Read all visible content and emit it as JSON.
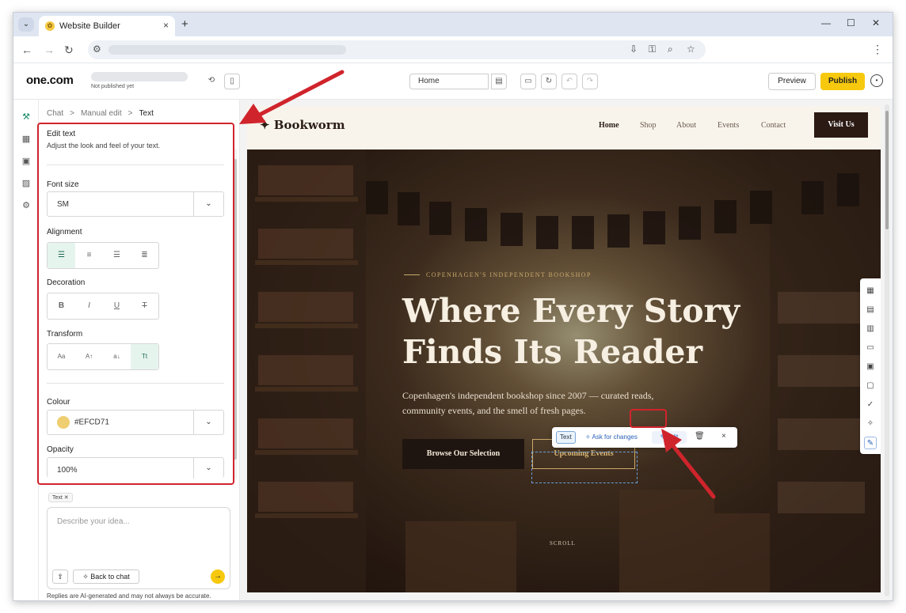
{
  "browser": {
    "tab_title": "Website Builder",
    "tab_close": "×",
    "new_tab": "+",
    "menu": "⋮"
  },
  "app": {
    "logo": "one.com",
    "status": "Not published yet",
    "page_select": "Home",
    "preview_label": "Preview",
    "publish_label": "Publish"
  },
  "panel": {
    "breadcrumb": [
      "Chat",
      "Manual edit",
      "Text"
    ],
    "breadcrumb_sep": ">",
    "title": "Edit text",
    "subtitle": "Adjust the look and feel of your text.",
    "font_size": {
      "label": "Font size",
      "value": "SM"
    },
    "alignment": {
      "label": "Alignment",
      "selected": "left"
    },
    "decoration": {
      "label": "Decoration",
      "options": [
        "B",
        "I",
        "U",
        "T"
      ]
    },
    "transform": {
      "label": "Transform",
      "options": [
        "Aa",
        "A↑",
        "a↓",
        "Tt"
      ],
      "selected": "Tt"
    },
    "colour": {
      "label": "Colour",
      "value": "#EFCD71",
      "swatch": "#EFCD71"
    },
    "opacity": {
      "label": "Opacity",
      "value": "100%"
    },
    "chip_label": "Text",
    "chip_close": "✕",
    "chat_placeholder": "Describe your idea...",
    "back_to_chat": "Back to chat",
    "disclaimer": "Replies are AI-generated and may not always be accurate."
  },
  "site": {
    "brand": "Bookworm",
    "nav": [
      "Home",
      "Shop",
      "About",
      "Events",
      "Contact"
    ],
    "visit_button": "Visit Us",
    "kicker": "COPENHAGEN'S INDEPENDENT BOOKSHOP",
    "headline_1": "Where Every Story",
    "headline_2": "Finds Its Reader",
    "sub_1": "Copenhagen's independent bookshop since 2007 — curated reads,",
    "sub_2": "community events, and the smell of fresh pages.",
    "browse_button": "Browse Our Selection",
    "events_button": "Upcoming Events",
    "scroll_label": "SCROLL"
  },
  "floating_toolbar": {
    "type_label": "Text",
    "ask_label": "Ask for changes",
    "edit_label": "Edit",
    "close": "×"
  },
  "colors": {
    "accent": "#f6c90e",
    "brand_dark": "#2b1a14",
    "annotation": "#d0242c",
    "selected_green": "#e6f4ee"
  }
}
